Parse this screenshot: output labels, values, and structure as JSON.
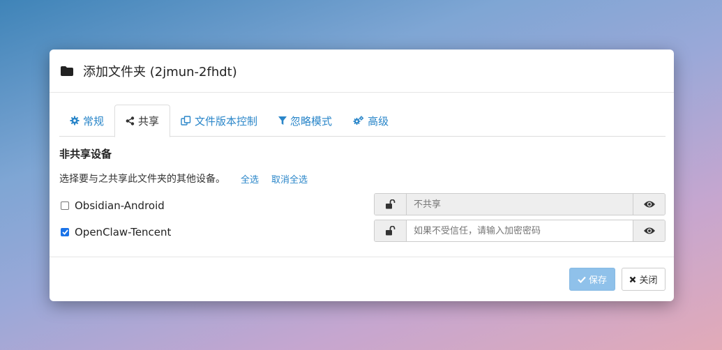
{
  "modal": {
    "title": "添加文件夹 (2jmun-2fhdt)",
    "tabs": [
      {
        "label": "常规",
        "icon": "gear-icon",
        "active": false
      },
      {
        "label": "共享",
        "icon": "share-icon",
        "active": true
      },
      {
        "label": "文件版本控制",
        "icon": "copy-icon",
        "active": false
      },
      {
        "label": "忽略模式",
        "icon": "filter-icon",
        "active": false
      },
      {
        "label": "高级",
        "icon": "cogs-icon",
        "active": false
      }
    ],
    "section_title": "非共享设备",
    "description": "选择要与之共享此文件夹的其他设备。",
    "select_all": "全选",
    "deselect_all": "取消全选",
    "devices": [
      {
        "name": "Obsidian-Android",
        "checked": false,
        "placeholder": "不共享",
        "disabled": true
      },
      {
        "name": "OpenClaw-Tencent",
        "checked": true,
        "placeholder": "如果不受信任，请输入加密密码",
        "disabled": false
      }
    ],
    "save_label": "保存",
    "close_label": "关闭"
  },
  "colors": {
    "link": "#2a86c9",
    "save_button": "#8fc1ea"
  }
}
